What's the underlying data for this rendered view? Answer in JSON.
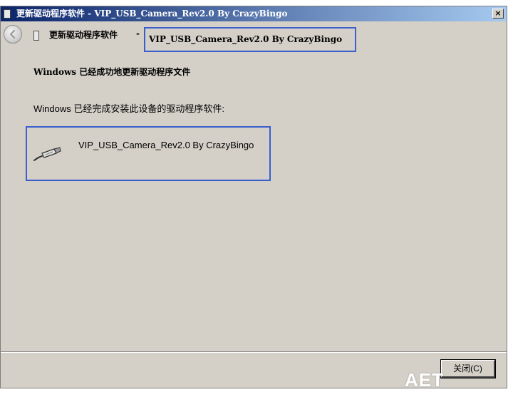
{
  "titlebar": {
    "title": "更新驱动程序软件 - VIP_USB_Camera_Rev2.0 By CrazyBingo",
    "close_glyph": "×"
  },
  "nav": {
    "label": "更新驱动程序软件",
    "separator": "-",
    "device": "VIP_USB_Camera_Rev2.0 By CrazyBingo"
  },
  "content": {
    "heading": "Windows 已经成功地更新驱动程序文件",
    "message": "Windows 已经完成安装此设备的驱动程序软件:",
    "device_name": "VIP_USB_Camera_Rev2.0 By CrazyBingo"
  },
  "footer": {
    "close_label": "关闭(C)"
  },
  "watermark": {
    "text": "AET"
  },
  "icons": {
    "back": "back-arrow-icon",
    "device": "usb-cable-icon"
  },
  "colors": {
    "titlebar_start": "#0a246a",
    "titlebar_end": "#a6caf0",
    "highlight_border": "#3a5fcd",
    "window_bg": "#d4d0c8"
  }
}
